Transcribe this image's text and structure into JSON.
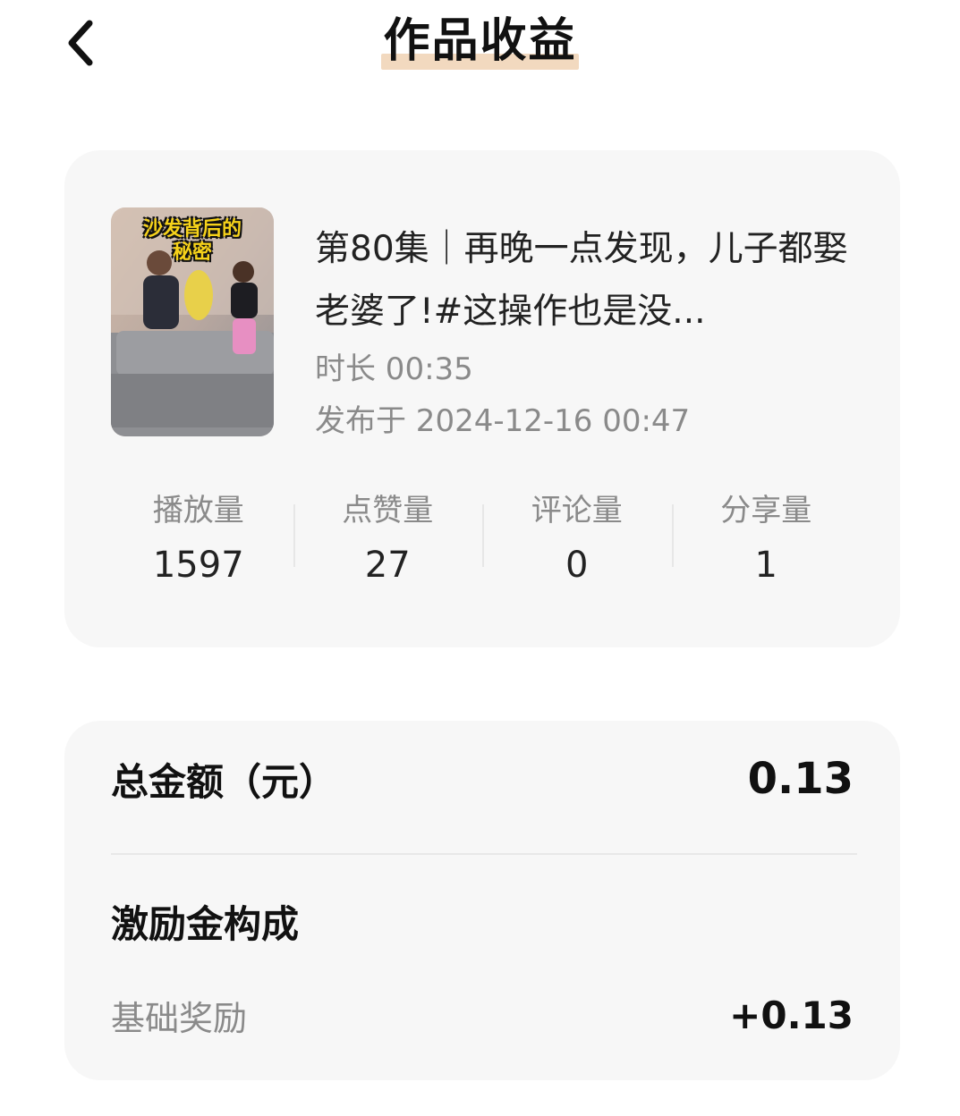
{
  "header": {
    "title": "作品收益"
  },
  "video": {
    "thumbnail_caption_line1": "沙发背后的",
    "thumbnail_caption_line2": "秘密",
    "title": "第80集｜再晚一点发现，儿子都娶老婆了!#这操作也是没...",
    "duration": "时长 00:35",
    "published": "发布于 2024-12-16 00:47"
  },
  "stats": [
    {
      "label": "播放量",
      "value": "1597"
    },
    {
      "label": "点赞量",
      "value": "27"
    },
    {
      "label": "评论量",
      "value": "0"
    },
    {
      "label": "分享量",
      "value": "1"
    }
  ],
  "earnings": {
    "total_label": "总金额（元）",
    "total_value": "0.13",
    "breakdown_title": "激励金构成",
    "items": [
      {
        "label": "基础奖励",
        "value": "+0.13"
      }
    ]
  },
  "colors": {
    "title_highlight": "#f2d9bf",
    "card_bg": "#f7f7f7",
    "secondary_text": "#8a8a8a",
    "thumb_caption": "#f6d21a"
  }
}
